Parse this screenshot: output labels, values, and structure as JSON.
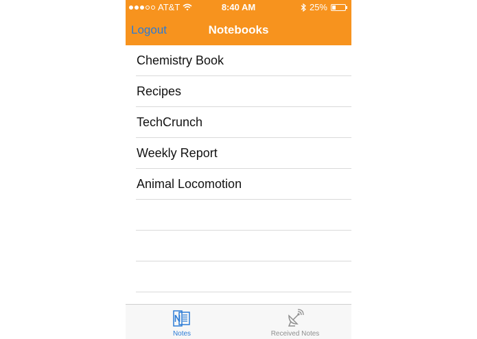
{
  "status_bar": {
    "carrier": "AT&T",
    "time": "8:40 AM",
    "battery_percent": "25%",
    "battery_level": 0.25,
    "signal_bars_filled": 3,
    "signal_bars_total": 5
  },
  "nav": {
    "left_button": "Logout",
    "title": "Notebooks"
  },
  "notebooks": [
    "Chemistry Book",
    "Recipes",
    "TechCrunch",
    "Weekly Report",
    "Animal Locomotion"
  ],
  "tabs": [
    {
      "label": "Notes",
      "icon": "notebook-icon",
      "selected": true
    },
    {
      "label": "Received Notes",
      "icon": "satellite-dish-icon",
      "selected": false
    }
  ],
  "colors": {
    "accent": "#f7931e",
    "link": "#2b7bd6",
    "separator": "#d9d9d9"
  }
}
